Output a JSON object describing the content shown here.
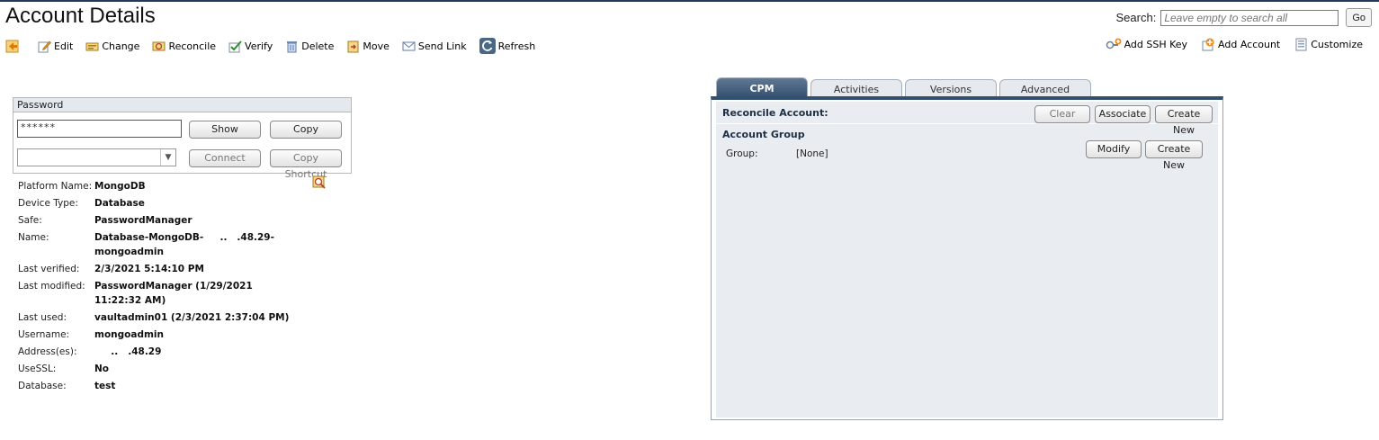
{
  "page": {
    "title": "Account Details"
  },
  "search": {
    "label": "Search:",
    "placeholder": "Leave empty to search all",
    "go_label": "Go"
  },
  "toolbar": {
    "items": [
      {
        "label": "Edit",
        "icon": "pencil-icon"
      },
      {
        "label": "Change",
        "icon": "change-icon"
      },
      {
        "label": "Reconcile",
        "icon": "reconcile-icon"
      },
      {
        "label": "Verify",
        "icon": "verify-icon"
      },
      {
        "label": "Delete",
        "icon": "trash-icon"
      },
      {
        "label": "Move",
        "icon": "move-icon"
      },
      {
        "label": "Send Link",
        "icon": "envelope-icon"
      },
      {
        "label": "Refresh",
        "icon": "refresh-icon"
      }
    ],
    "right_items": [
      {
        "label": "Add SSH Key",
        "icon": "ssh-key-icon"
      },
      {
        "label": "Add Account",
        "icon": "add-account-icon"
      },
      {
        "label": "Customize",
        "icon": "customize-icon"
      }
    ]
  },
  "password": {
    "header": "Password",
    "value": "******",
    "show_label": "Show",
    "copy_label": "Copy",
    "connect_label": "Connect",
    "copy_shortcut_label": "Copy Shortcut"
  },
  "properties": [
    {
      "label": "Platform Name:",
      "value": "MongoDB"
    },
    {
      "label": "Device Type:",
      "value": "Database"
    },
    {
      "label": "Safe:",
      "value": "PasswordManager"
    },
    {
      "label": "Name:",
      "value": "Database-MongoDB-     ..   .48.29-mongoadmin"
    },
    {
      "label": "Last verified:",
      "value": "2/3/2021 5:14:10 PM"
    },
    {
      "label": "Last modified:",
      "value": "PasswordManager (1/29/2021 11:22:32 AM)"
    },
    {
      "label": "Last used:",
      "value": "vaultadmin01 (2/3/2021 2:37:04 PM)"
    },
    {
      "label": "Username:",
      "value": "mongoadmin"
    },
    {
      "label": "Address(es):",
      "value": "     ..   .48.29"
    },
    {
      "label": "UseSSL:",
      "value": "No"
    },
    {
      "label": "Database:",
      "value": "test"
    }
  ],
  "tabs": [
    {
      "label": "CPM",
      "active": true
    },
    {
      "label": "Activities",
      "active": false
    },
    {
      "label": "Versions",
      "active": false
    },
    {
      "label": "Advanced",
      "active": false
    }
  ],
  "cpm": {
    "reconcile_label": "Reconcile Account:",
    "clear_label": "Clear",
    "associate_label": "Associate",
    "create_new_label": "Create New",
    "account_group_title": "Account Group",
    "group_label": "Group:",
    "group_value": "[None]",
    "modify_label": "Modify",
    "group_create_new_label": "Create New"
  }
}
